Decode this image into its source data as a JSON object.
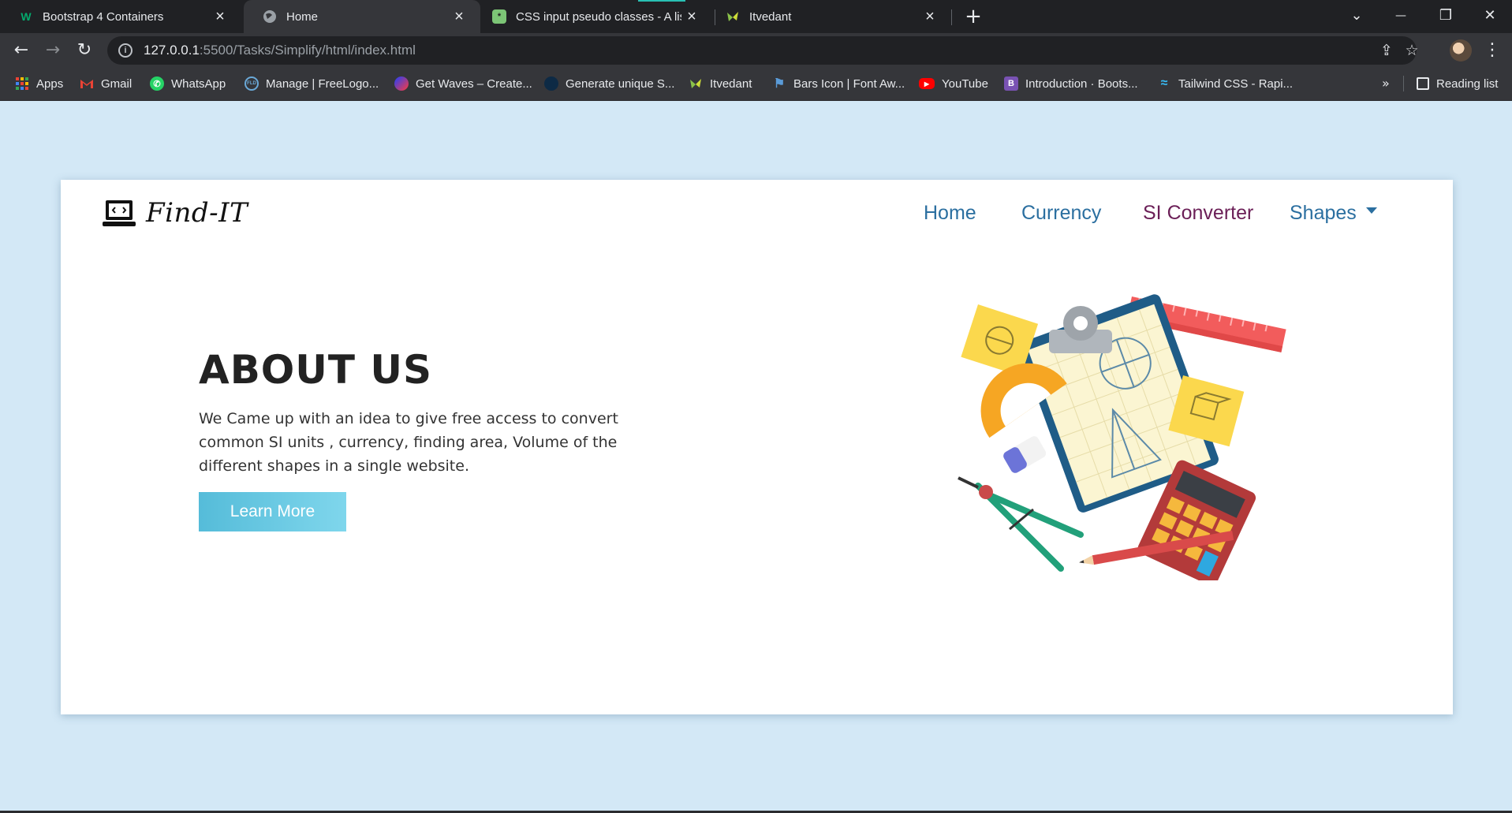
{
  "browser": {
    "tabs": [
      {
        "title": "Bootstrap 4 Containers",
        "icon": "w3schools-icon"
      },
      {
        "title": "Home",
        "icon": "globe-icon"
      },
      {
        "title": "CSS input pseudo classes - A list",
        "icon": "css-tricks-icon"
      },
      {
        "title": "Itvedant",
        "icon": "itvedant-icon"
      }
    ],
    "window_controls": {
      "dropdown": "⌄",
      "minimize": "—",
      "restore": "❐",
      "close": "✕"
    },
    "url_host": "127.0.0.1",
    "url_path": ":5500/Tasks/Simplify/html/index.html",
    "bookmarks": [
      {
        "label": "Apps",
        "icon": "apps-grid-icon"
      },
      {
        "label": "Gmail",
        "icon": "gmail-icon"
      },
      {
        "label": "WhatsApp",
        "icon": "whatsapp-icon"
      },
      {
        "label": "Manage | FreeLogo...",
        "icon": "freelogo-icon"
      },
      {
        "label": "Get Waves – Create...",
        "icon": "getwaves-icon"
      },
      {
        "label": "Generate unique S...",
        "icon": "blob-icon"
      },
      {
        "label": "Itvedant",
        "icon": "itvedant-icon"
      },
      {
        "label": "Bars Icon | Font Aw...",
        "icon": "flag-icon"
      },
      {
        "label": "YouTube",
        "icon": "youtube-icon"
      },
      {
        "label": "Introduction · Boots...",
        "icon": "bootstrap-icon"
      },
      {
        "label": "Tailwind CSS - Rapi...",
        "icon": "tailwind-icon"
      }
    ],
    "bookmarks_overflow": "»",
    "reading_list": "Reading list"
  },
  "site": {
    "logo_text": "Find-IT",
    "nav": [
      {
        "label": "Home",
        "active": false
      },
      {
        "label": "Currency",
        "active": false
      },
      {
        "label": "SI Converter",
        "active": true
      },
      {
        "label": "Shapes",
        "active": false,
        "dropdown": true
      }
    ],
    "hero": {
      "heading": "ABOUT US",
      "description": "We Came up with an idea to give free access to convert common SI units , currency, finding area, Volume of the different shapes in a single website.",
      "button": "Learn More"
    }
  },
  "colors": {
    "page_background": "#d3e8f6",
    "nav_link": "#2b6fa0",
    "nav_active": "#6b1f57",
    "button": "#5cc3de"
  }
}
